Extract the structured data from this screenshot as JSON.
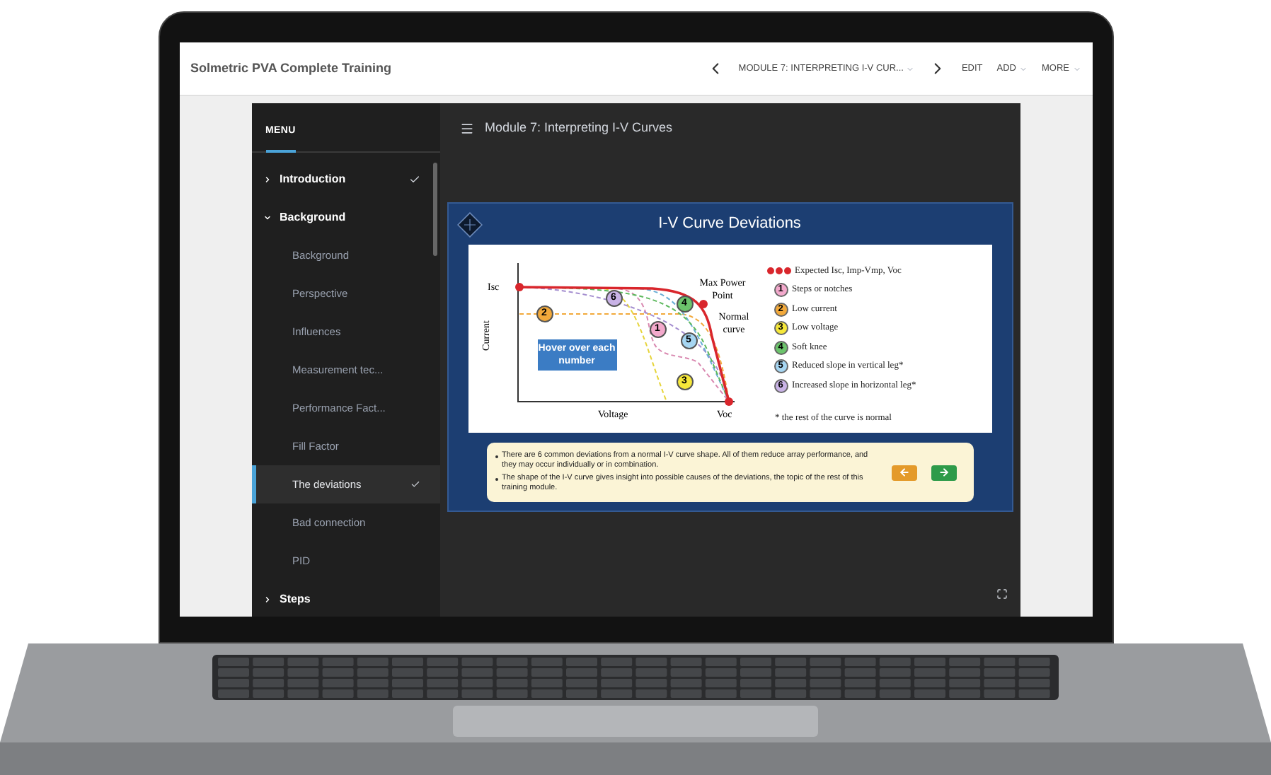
{
  "header": {
    "title": "Solmetric PVA Complete Training",
    "module_select": "MODULE 7: INTERPRETING I-V CUR...",
    "actions": [
      {
        "label": "EDIT",
        "dropdown": false
      },
      {
        "label": "ADD",
        "dropdown": true
      },
      {
        "label": "MORE",
        "dropdown": true
      }
    ]
  },
  "sidebar": {
    "heading": "MENU",
    "items": [
      {
        "label": "Introduction",
        "expanded": false,
        "completed": true
      },
      {
        "label": "Background",
        "expanded": true,
        "completed": false,
        "children": [
          {
            "label": "Background",
            "selected": false,
            "completed": false
          },
          {
            "label": "Perspective",
            "selected": false,
            "completed": false
          },
          {
            "label": "Influences",
            "selected": false,
            "completed": false
          },
          {
            "label": "Measurement tec...",
            "selected": false,
            "completed": false
          },
          {
            "label": "Performance Fact...",
            "selected": false,
            "completed": false
          },
          {
            "label": "Fill Factor",
            "selected": false,
            "completed": false
          },
          {
            "label": "The deviations",
            "selected": true,
            "completed": true
          },
          {
            "label": "Bad connection",
            "selected": false,
            "completed": false
          },
          {
            "label": "PID",
            "selected": false,
            "completed": false
          }
        ]
      },
      {
        "label": "Steps",
        "expanded": false,
        "completed": false
      }
    ]
  },
  "main": {
    "title": "Module 7: Interpreting I-V Curves",
    "slide": {
      "title": "I-V Curve Deviations",
      "chart": {
        "isc": "Isc",
        "voc": "Voc",
        "ylabel": "Current",
        "xlabel": "Voltage",
        "mpp": "Max Power Point",
        "normal": "Normal curve",
        "hint": "Hover over each number",
        "markers": [
          {
            "number": "6",
            "color": "#c9b3e6"
          },
          {
            "number": "2",
            "color": "#f2a93b"
          },
          {
            "number": "4",
            "color": "#6cc46c"
          },
          {
            "number": "1",
            "color": "#f3a9cc"
          },
          {
            "number": "5",
            "color": "#a6d6f2"
          },
          {
            "number": "3",
            "color": "#f6e83a"
          }
        ]
      },
      "legend": [
        {
          "kind": "dots",
          "label": "Expected Isc, Imp-Vmp, Voc",
          "color": "#d9262c"
        },
        {
          "kind": "number",
          "number": "1",
          "label": "Steps or notches",
          "color": "#f3a9cc"
        },
        {
          "kind": "number",
          "number": "2",
          "label": "Low current",
          "color": "#f2a93b"
        },
        {
          "kind": "number",
          "number": "3",
          "label": "Low voltage",
          "color": "#f6e83a"
        },
        {
          "kind": "number",
          "number": "4",
          "label": "Soft knee",
          "color": "#6cc46c"
        },
        {
          "kind": "number",
          "number": "5",
          "label": "Reduced slope in vertical leg*",
          "color": "#a6d6f2"
        },
        {
          "kind": "number",
          "number": "6",
          "label": "Increased slope in horizontal leg*",
          "color": "#c9b3e6"
        },
        {
          "kind": "note",
          "label": "* the rest of the curve is normal"
        }
      ],
      "bullets": [
        "There are 6 common deviations from a normal I-V curve shape. All of them reduce array performance, and they may occur individually or in combination.",
        "The shape of the I-V curve gives insight into possible causes of the deviations, the topic of the rest of this training module."
      ]
    }
  }
}
